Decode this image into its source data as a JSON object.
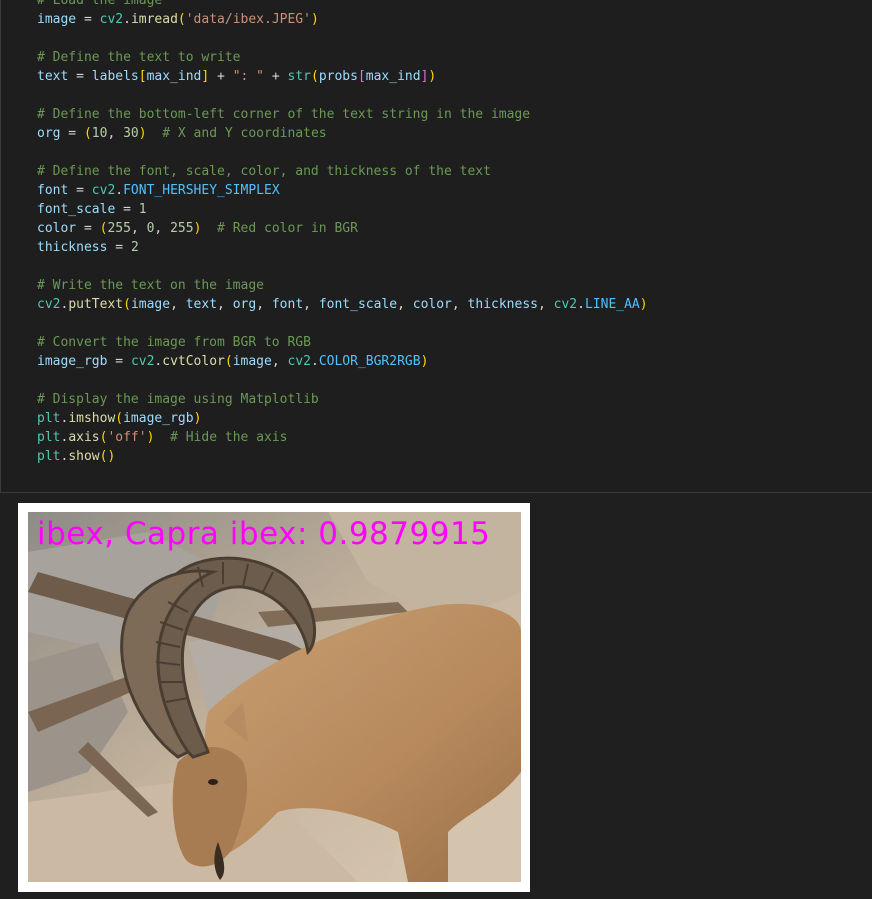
{
  "code_lines": [
    [
      [
        "# Load the image",
        "cm"
      ]
    ],
    [
      [
        "image",
        "v"
      ],
      [
        " = ",
        ""
      ],
      [
        "cv2",
        "m"
      ],
      [
        ".",
        ""
      ],
      [
        "imread",
        "f"
      ],
      [
        "(",
        "p"
      ],
      [
        "'data/ibex.JPEG'",
        "s"
      ],
      [
        ")",
        "p"
      ]
    ],
    [],
    [
      [
        "# Define the text to write",
        "cm"
      ]
    ],
    [
      [
        "text",
        "v"
      ],
      [
        " = ",
        ""
      ],
      [
        "labels",
        "v"
      ],
      [
        "[",
        "p"
      ],
      [
        "max_ind",
        "v"
      ],
      [
        "]",
        "p"
      ],
      [
        " + ",
        ""
      ],
      [
        "\": \"",
        "s"
      ],
      [
        " + ",
        ""
      ],
      [
        "str",
        "m"
      ],
      [
        "(",
        "p"
      ],
      [
        "probs",
        "v"
      ],
      [
        "[",
        "p2"
      ],
      [
        "max_ind",
        "v"
      ],
      [
        "]",
        "p2"
      ],
      [
        ")",
        "p"
      ]
    ],
    [],
    [
      [
        "# Define the bottom-left corner of the text string in the image",
        "cm"
      ]
    ],
    [
      [
        "org",
        "v"
      ],
      [
        " = ",
        ""
      ],
      [
        "(",
        "p"
      ],
      [
        "10",
        "n"
      ],
      [
        ", ",
        ""
      ],
      [
        "30",
        "n"
      ],
      [
        ")",
        "p"
      ],
      [
        "  # X and Y coordinates",
        "cm"
      ]
    ],
    [],
    [
      [
        "# Define the font, scale, color, and thickness of the text",
        "cm"
      ]
    ],
    [
      [
        "font",
        "v"
      ],
      [
        " = ",
        ""
      ],
      [
        "cv2",
        "m"
      ],
      [
        ".",
        ""
      ],
      [
        "FONT_HERSHEY_SIMPLEX",
        "c"
      ]
    ],
    [
      [
        "font_scale",
        "v"
      ],
      [
        " = ",
        ""
      ],
      [
        "1",
        "n"
      ]
    ],
    [
      [
        "color",
        "v"
      ],
      [
        " = ",
        ""
      ],
      [
        "(",
        "p"
      ],
      [
        "255",
        "n"
      ],
      [
        ", ",
        ""
      ],
      [
        "0",
        "n"
      ],
      [
        ", ",
        ""
      ],
      [
        "255",
        "n"
      ],
      [
        ")",
        "p"
      ],
      [
        "  # Red color in BGR",
        "cm"
      ]
    ],
    [
      [
        "thickness",
        "v"
      ],
      [
        " = ",
        ""
      ],
      [
        "2",
        "n"
      ]
    ],
    [],
    [
      [
        "# Write the text on the image",
        "cm"
      ]
    ],
    [
      [
        "cv2",
        "m"
      ],
      [
        ".",
        ""
      ],
      [
        "putText",
        "f"
      ],
      [
        "(",
        "p"
      ],
      [
        "image",
        "v"
      ],
      [
        ", ",
        ""
      ],
      [
        "text",
        "v"
      ],
      [
        ", ",
        ""
      ],
      [
        "org",
        "v"
      ],
      [
        ", ",
        ""
      ],
      [
        "font",
        "v"
      ],
      [
        ", ",
        ""
      ],
      [
        "font_scale",
        "v"
      ],
      [
        ", ",
        ""
      ],
      [
        "color",
        "v"
      ],
      [
        ", ",
        ""
      ],
      [
        "thickness",
        "v"
      ],
      [
        ", ",
        ""
      ],
      [
        "cv2",
        "m"
      ],
      [
        ".",
        ""
      ],
      [
        "LINE_AA",
        "c"
      ],
      [
        ")",
        "p"
      ]
    ],
    [],
    [
      [
        "# Convert the image from BGR to RGB",
        "cm"
      ]
    ],
    [
      [
        "image_rgb",
        "v"
      ],
      [
        " = ",
        ""
      ],
      [
        "cv2",
        "m"
      ],
      [
        ".",
        ""
      ],
      [
        "cvtColor",
        "f"
      ],
      [
        "(",
        "p"
      ],
      [
        "image",
        "v"
      ],
      [
        ", ",
        ""
      ],
      [
        "cv2",
        "m"
      ],
      [
        ".",
        ""
      ],
      [
        "COLOR_BGR2RGB",
        "c"
      ],
      [
        ")",
        "p"
      ]
    ],
    [],
    [
      [
        "# Display the image using Matplotlib",
        "cm"
      ]
    ],
    [
      [
        "plt",
        "m"
      ],
      [
        ".",
        ""
      ],
      [
        "imshow",
        "f"
      ],
      [
        "(",
        "p"
      ],
      [
        "image_rgb",
        "v"
      ],
      [
        ")",
        "p"
      ]
    ],
    [
      [
        "plt",
        "m"
      ],
      [
        ".",
        ""
      ],
      [
        "axis",
        "f"
      ],
      [
        "(",
        "p"
      ],
      [
        "'off'",
        "s"
      ],
      [
        ")",
        "p"
      ],
      [
        "  # Hide the axis",
        "cm"
      ]
    ],
    [
      [
        "plt",
        "m"
      ],
      [
        ".",
        ""
      ],
      [
        "show",
        "f"
      ],
      [
        "(",
        "p"
      ],
      [
        ")",
        "p"
      ]
    ]
  ],
  "output": {
    "overlay_text": "ibex, Capra ibex: 0.9879915",
    "overlay_color": "#ff00ff",
    "image_subject": "ibex"
  },
  "theme": {
    "background": "#1e1e1e",
    "comment": "#6a9955",
    "variable": "#9cdcfe",
    "module": "#4ec9b0",
    "function": "#dcdcaa",
    "string": "#ce9178",
    "number": "#b5cea8",
    "bracket": "#ffd700"
  }
}
